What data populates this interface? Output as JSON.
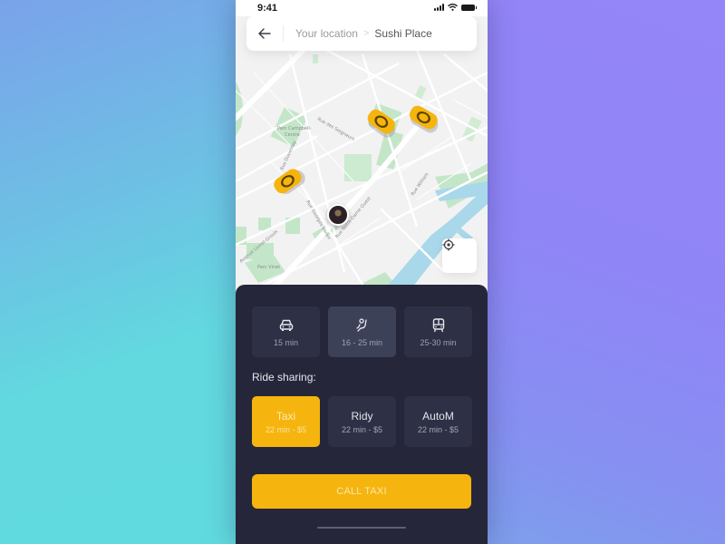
{
  "status_bar": {
    "time": "9:41",
    "icons": [
      "signal-icon",
      "wifi-icon",
      "battery-icon"
    ]
  },
  "header": {
    "back_icon": "arrow-left-icon",
    "origin": "Your location",
    "separator": ">",
    "destination": "Sushi Place"
  },
  "map": {
    "labels": [
      "Parc Campbell-Centre",
      "Rue des Seigneurs",
      "Rue Duvernay",
      "Rue Georges-Vanier",
      "Rue Notre-Dame Ouest",
      "Rue William",
      "Avenue Lionel-Groulx",
      "Parc Vinet"
    ],
    "markers": {
      "taxis": 3,
      "user_avatar": "user-avatar"
    },
    "locate_button_icon": "crosshair-icon"
  },
  "ride_modes": [
    {
      "icon": "car-icon",
      "label": "15 min",
      "active": false
    },
    {
      "icon": "walking-ride-icon",
      "label": "16 - 25 min",
      "active": true
    },
    {
      "icon": "bus-icon",
      "label": "25-30 min",
      "active": false
    }
  ],
  "ride_sharing": {
    "title": "Ride sharing:",
    "services": [
      {
        "name": "Taxi",
        "meta": "22 min - $5",
        "active": true
      },
      {
        "name": "Ridy",
        "meta": "22 min - $5",
        "active": false
      },
      {
        "name": "AutoM",
        "meta": "22 min - $5",
        "active": false
      }
    ]
  },
  "call_button": {
    "label": "CALL TAXI"
  },
  "colors": {
    "accent": "#f5b50e",
    "sheet_bg": "#25263a",
    "card_bg": "#2e3045",
    "card_active_bg": "#3d4157",
    "map_water": "#a8d8ea",
    "map_park": "#c4e6c8"
  }
}
